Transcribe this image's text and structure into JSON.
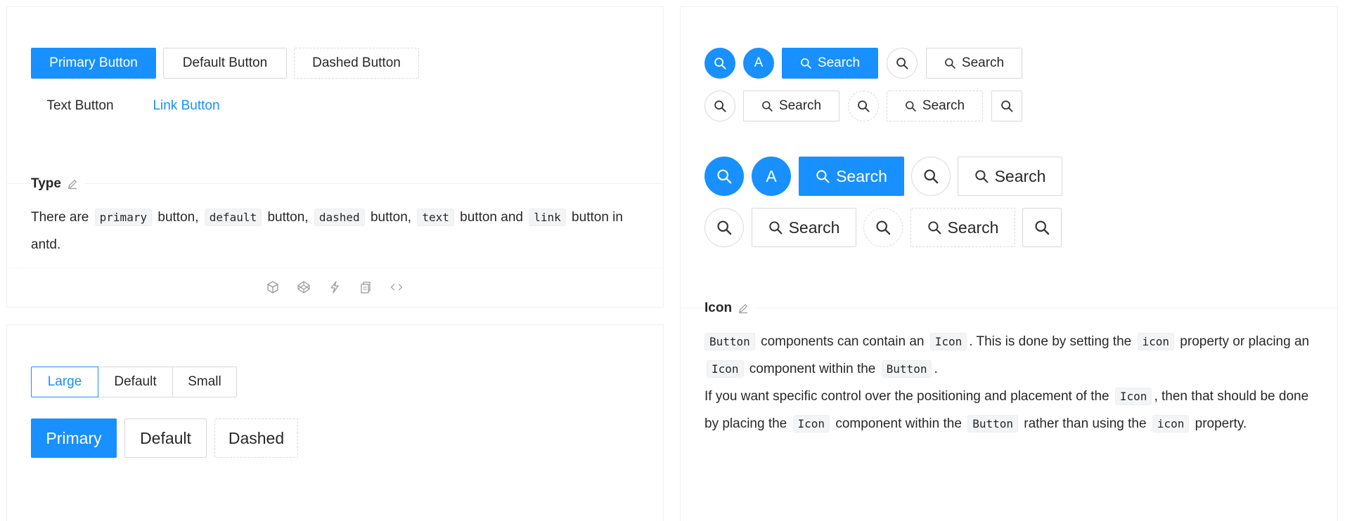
{
  "type_demo": {
    "buttons": {
      "primary": "Primary Button",
      "default": "Default Button",
      "dashed": "Dashed Button",
      "text": "Text Button",
      "link": "Link Button"
    },
    "title": "Type",
    "desc": {
      "p1": "There are ",
      "c1": "primary",
      "p2": " button, ",
      "c2": "default",
      "p3": " button, ",
      "c3": "dashed",
      "p4": " button, ",
      "c4": "text",
      "p5": " button and ",
      "c5": "link",
      "p6": " button in antd."
    },
    "actions": [
      "codesandbox-icon",
      "codepen-icon",
      "thunderbolt-icon",
      "copy-icon",
      "code-icon"
    ]
  },
  "size_demo": {
    "sizes": [
      "Large",
      "Default",
      "Small"
    ],
    "selected": "Large",
    "buttons": {
      "primary": "Primary",
      "default": "Default",
      "dashed": "Dashed"
    }
  },
  "icon_demo": {
    "avatar_letter": "A",
    "search_label": "Search",
    "title": "Icon",
    "desc": {
      "a1": "Button",
      "a2": " components can contain an ",
      "a3": "Icon",
      "a4": ". This is done by setting the ",
      "a5": "icon",
      "a6": " property or placing an ",
      "a7": "Icon",
      "a8": " component within the ",
      "a9": "Button",
      "a10": ".",
      "b1": "If you want specific control over the positioning and placement of the ",
      "b2": "Icon",
      "b3": ", then that should be done by placing the ",
      "b4": "Icon",
      "b5": " component within the ",
      "b6": "Button",
      "b7": " rather than using the ",
      "b8": "icon",
      "b9": " property."
    }
  },
  "colors": {
    "primary": "#1890ff",
    "border": "#d9d9d9",
    "divider": "#f0f0f0"
  }
}
